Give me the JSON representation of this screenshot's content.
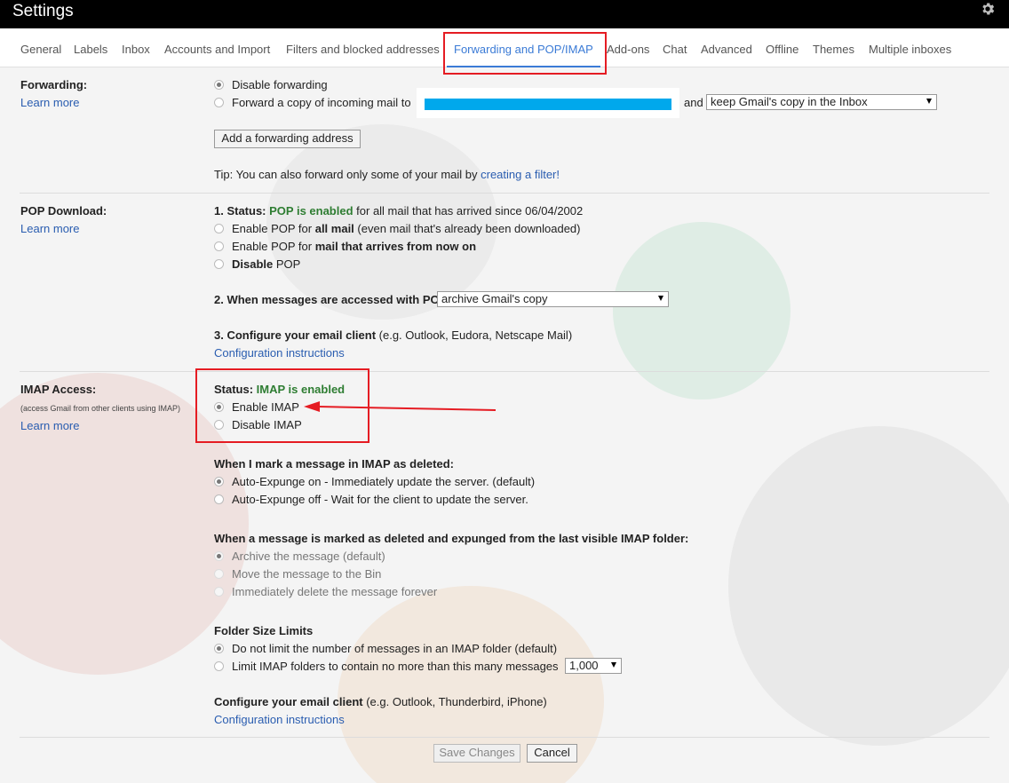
{
  "app": {
    "title": "Settings"
  },
  "tabs": [
    {
      "label": "General"
    },
    {
      "label": "Labels"
    },
    {
      "label": "Inbox"
    },
    {
      "label": "Accounts and Import"
    },
    {
      "label": "Filters and blocked addresses"
    },
    {
      "label": "Forwarding and POP/IMAP",
      "active": true
    },
    {
      "label": "Add-ons"
    },
    {
      "label": "Chat"
    },
    {
      "label": "Advanced"
    },
    {
      "label": "Offline"
    },
    {
      "label": "Themes"
    },
    {
      "label": "Multiple inboxes"
    }
  ],
  "forwarding": {
    "label": "Forwarding:",
    "learn_more": "Learn more",
    "disable": "Disable forwarding",
    "forward_copy": "Forward a copy of incoming mail to",
    "and": "and",
    "keep_select": "keep Gmail's copy in the Inbox",
    "add_button": "Add a forwarding address",
    "tip_prefix": "Tip: You can also forward only some of your mail by ",
    "tip_link": "creating a filter!"
  },
  "pop": {
    "label": "POP Download:",
    "learn_more": "Learn more",
    "status_prefix": "1. Status: ",
    "status_value": "POP is enabled",
    "status_suffix": " for all mail that has arrived since 06/04/2002",
    "opt1_pre": "Enable POP for ",
    "opt1_bold": "all mail",
    "opt1_post": " (even mail that's already been downloaded)",
    "opt2_pre": "Enable POP for ",
    "opt2_bold": "mail that arrives from now on",
    "opt3_bold": "Disable",
    "opt3_post": " POP",
    "accessed_label": "2. When messages are accessed with POP",
    "accessed_select": "archive Gmail's copy",
    "configure_bold": "3. Configure your email client",
    "configure_rest": " (e.g. Outlook, Eudora, Netscape Mail)",
    "config_link": "Configuration instructions"
  },
  "imap": {
    "label": "IMAP Access:",
    "sublabel": "(access Gmail from other clients using IMAP)",
    "learn_more": "Learn more",
    "status_prefix": "Status: ",
    "status_value": "IMAP is enabled",
    "enable": "Enable IMAP",
    "disable": "Disable IMAP",
    "deleted_heading": "When I mark a message in IMAP as deleted:",
    "expunge_on": "Auto-Expunge on - Immediately update the server. (default)",
    "expunge_off": "Auto-Expunge off - Wait for the client to update the server.",
    "expunged_heading": "When a message is marked as deleted and expunged from the last visible IMAP folder:",
    "archive": "Archive the message (default)",
    "move_bin": "Move the message to the Bin",
    "delete_forever": "Immediately delete the message forever",
    "folder_heading": "Folder Size Limits",
    "no_limit": "Do not limit the number of messages in an IMAP folder (default)",
    "limit": "Limit IMAP folders to contain no more than this many messages",
    "limit_select": "1,000",
    "configure_bold": "Configure your email client",
    "configure_rest": " (e.g. Outlook, Thunderbird, iPhone)",
    "config_link": "Configuration instructions"
  },
  "footer": {
    "save": "Save Changes",
    "cancel": "Cancel"
  },
  "colors": {
    "accent": "#3b7bd6",
    "link": "#2a5db0",
    "enabled_green": "#2e7d32",
    "annotation_red": "#e51c23",
    "redaction_blue": "#00a8ec"
  }
}
